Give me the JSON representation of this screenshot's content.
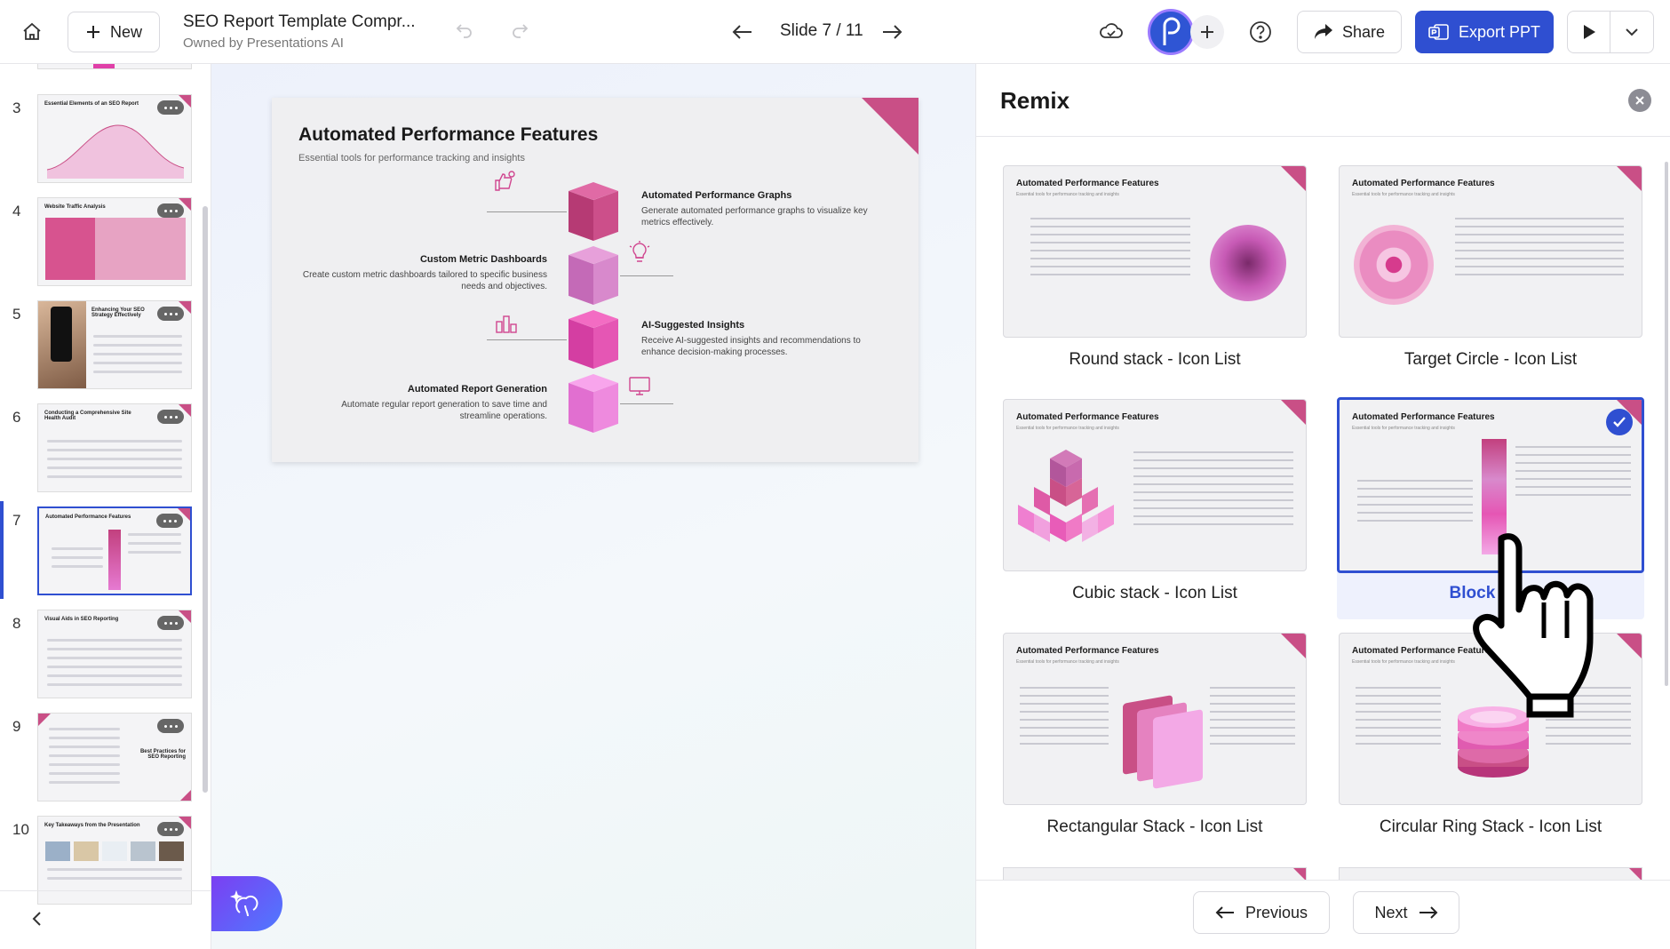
{
  "topbar": {
    "new_label": "New",
    "doc_title": "SEO Report Template Compr...",
    "doc_owner": "Owned by Presentations AI",
    "slide_counter": "Slide 7 / 11",
    "share_label": "Share",
    "export_label": "Export PPT"
  },
  "sidebar": {
    "slides": [
      {
        "num": "3",
        "title": "Essential Elements of an SEO Report"
      },
      {
        "num": "4",
        "title": "Website Traffic Analysis"
      },
      {
        "num": "5",
        "title": "Enhancing Your SEO Strategy Effectively"
      },
      {
        "num": "6",
        "title": "Conducting a Comprehensive Site Health Audit"
      },
      {
        "num": "7",
        "title": "Automated Performance Features"
      },
      {
        "num": "8",
        "title": "Visual Aids in SEO Reporting"
      },
      {
        "num": "9",
        "title": "Best Practices for SEO Reporting"
      },
      {
        "num": "10",
        "title": "Key Takeaways from the Presentation"
      }
    ],
    "active_index": 4
  },
  "slide": {
    "title": "Automated Performance Features",
    "subtitle": "Essential tools for performance tracking and insights",
    "features": [
      {
        "title": "Automated Performance Graphs",
        "desc": "Generate automated performance graphs to visualize key metrics effectively."
      },
      {
        "title": "Custom Metric Dashboards",
        "desc": "Create custom metric dashboards tailored to specific business needs and objectives."
      },
      {
        "title": "AI-Suggested Insights",
        "desc": "Receive AI-suggested insights and recommendations to enhance decision-making processes."
      },
      {
        "title": "Automated Report Generation",
        "desc": "Automate regular report generation to save time and streamline operations."
      }
    ]
  },
  "remix": {
    "title": "Remix",
    "card_slide_title": "Automated Performance Features",
    "card_slide_subtitle": "Essential tools for performance tracking and insights",
    "options": [
      {
        "label": "Round stack - Icon List"
      },
      {
        "label": "Target Circle - Icon List"
      },
      {
        "label": "Cubic stack - Icon List"
      },
      {
        "label": "Block Cha"
      },
      {
        "label": "Rectangular Stack - Icon List"
      },
      {
        "label": "Circular Ring Stack - Icon List"
      }
    ],
    "selected_index": 3,
    "previous_label": "Previous",
    "next_label": "Next"
  },
  "colors": {
    "accent": "#2f4fd1",
    "brand_pink": "#c94f86",
    "magenta": "#e040a8"
  }
}
